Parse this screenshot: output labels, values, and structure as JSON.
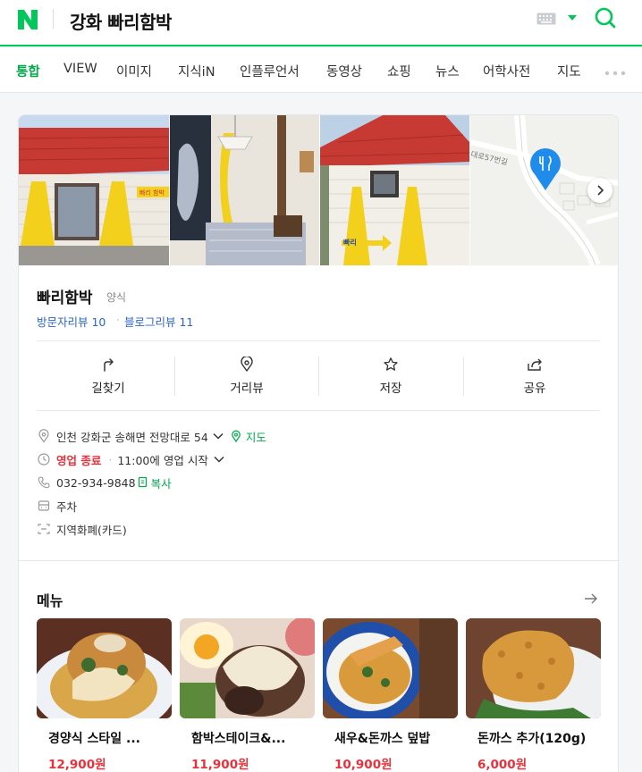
{
  "header": {
    "logo_letter": "N",
    "query": "강화 빠리함박",
    "accent_color": "#03c75a",
    "icons": [
      "keyboard-icon",
      "dropdown-arrow-icon",
      "search-icon"
    ]
  },
  "tabs": [
    {
      "label": "통합",
      "active": true
    },
    {
      "label": "VIEW"
    },
    {
      "label": "이미지"
    },
    {
      "label": "지식iN"
    },
    {
      "label": "인플루언서"
    },
    {
      "label": "동영상"
    },
    {
      "label": "쇼핑"
    },
    {
      "label": "뉴스"
    },
    {
      "label": "어학사전"
    },
    {
      "label": "지도"
    }
  ],
  "place": {
    "name": "빠리함박",
    "category": "양식",
    "visitor_review_label": "방문자리뷰 10",
    "blog_review_label": "블로그리뷰 11",
    "photos": {
      "sign_text": "빠리 함박",
      "arrow_sign_text": "빠리",
      "map_street_label": "대로57번길"
    }
  },
  "actions": [
    {
      "label": "길찾기",
      "icon": "directions-icon"
    },
    {
      "label": "거리뷰",
      "icon": "street-view-icon"
    },
    {
      "label": "저장",
      "icon": "star-icon"
    },
    {
      "label": "공유",
      "icon": "share-icon"
    }
  ],
  "info": {
    "address": "인천 강화군 송해면 전망대로 54",
    "map_link": "지도",
    "status": "영업 종료",
    "hours": "11:00에 영업 시작",
    "phone": "032-934-9848",
    "copy_label": "복사",
    "parking": "주차",
    "payment": "지역화폐(카드)"
  },
  "menu": {
    "title": "메뉴",
    "items": [
      {
        "name": "경양식 스타일 ...",
        "price": "12,900원"
      },
      {
        "name": "함박스테이크&...",
        "price": "11,900원"
      },
      {
        "name": "새우&돈까스 덮밥",
        "price": "10,900원"
      },
      {
        "name": "돈까스 추가(120g)",
        "price": "6,000원"
      }
    ]
  }
}
